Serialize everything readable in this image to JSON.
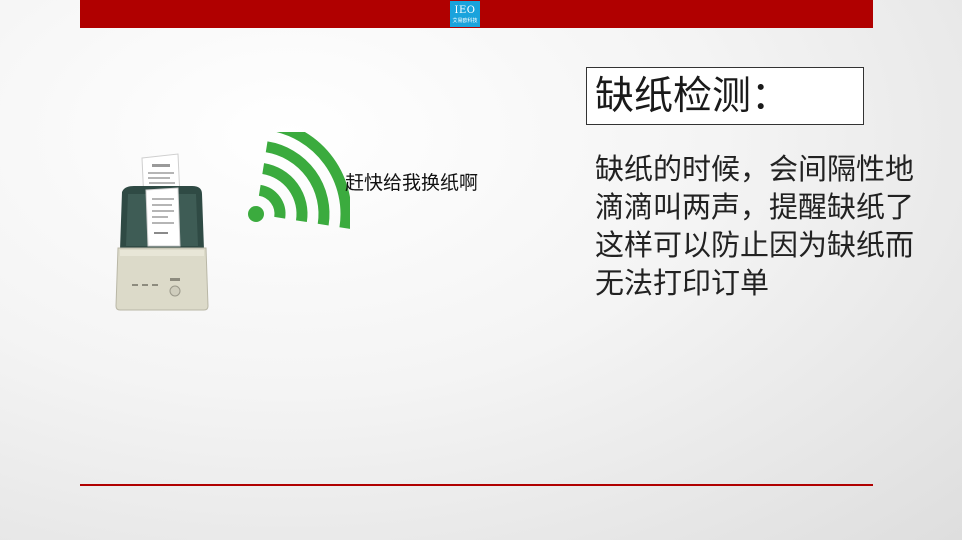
{
  "slide": {
    "logo_main": "IEO",
    "logo_sub": "艾易欧科技",
    "title": "缺纸检测：",
    "description_lines": [
      "缺纸的时候，会间隔性地",
      "滴滴叫两声，提醒缺纸了",
      "这样可以防止因为缺纸而",
      "无法打印订单"
    ],
    "callout": "赶快给我换纸啊"
  },
  "icons": {
    "printer": "receipt-printer-icon",
    "signal": "wireless-signal-icon"
  },
  "colors": {
    "accent_red": "#b00000",
    "logo_blue": "#1aa3dc",
    "signal_green": "#3bab3e"
  }
}
